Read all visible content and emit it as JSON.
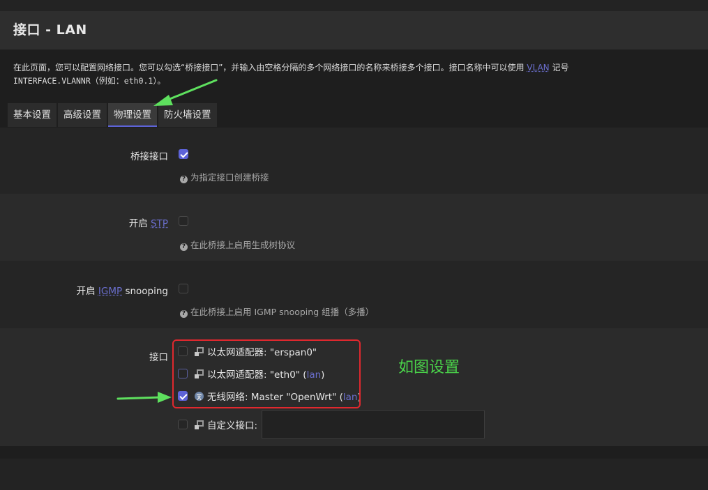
{
  "page": {
    "title": "接口 - LAN",
    "description_part1": "在此页面，您可以配置网络接口。您可以勾选“桥接接口”，并输入由空格分隔的多个网络接口的名称来桥接多个接口。接口名称中可以使用",
    "description_vlan": "VLAN",
    "description_part2": "记号",
    "description_code": "INTERFACE.VLANNR",
    "description_part3": "（例如：",
    "description_example": "eth0.1",
    "description_part4": "）。"
  },
  "tabs": [
    {
      "label": "基本设置"
    },
    {
      "label": "高级设置"
    },
    {
      "label": "物理设置"
    },
    {
      "label": "防火墙设置"
    }
  ],
  "active_tab": "物理设置",
  "bridge": {
    "label": "桥接接口",
    "checked": true,
    "hint": "为指定接口创建桥接"
  },
  "stp": {
    "label_prefix": "开启",
    "label_abbr": "STP",
    "checked": false,
    "hint": "在此桥接上启用生成树协议"
  },
  "igmp": {
    "label_prefix": "开启",
    "label_abbr": "IGMP",
    "label_suffix": "snooping",
    "checked": false,
    "hint": "在此桥接上启用 IGMP snooping 组播（多播）"
  },
  "interfaces": {
    "label": "接口",
    "items": [
      {
        "text": "以太网适配器: \"erspan0\"",
        "zone": "",
        "checked": false,
        "icon": "ethernet-icon"
      },
      {
        "text": "以太网适配器: \"eth0\" (",
        "zone": "lan",
        "suffix": ")",
        "checked": false,
        "icon": "ethernet-icon"
      },
      {
        "text": "无线网络: Master \"OpenWrt\" (",
        "zone": "lan",
        "suffix": ")",
        "checked": true,
        "icon": "wifi-icon"
      },
      {
        "text": "自定义接口:",
        "zone": "",
        "checked": false,
        "icon": "ethernet-icon"
      }
    ],
    "custom_value": ""
  },
  "annotation": {
    "text": "如图设置",
    "color": "#4ad34a"
  },
  "colors": {
    "accent": "#5d63d8",
    "zone_link": "#6b6fcf",
    "highlight_box": "#e0282e"
  }
}
